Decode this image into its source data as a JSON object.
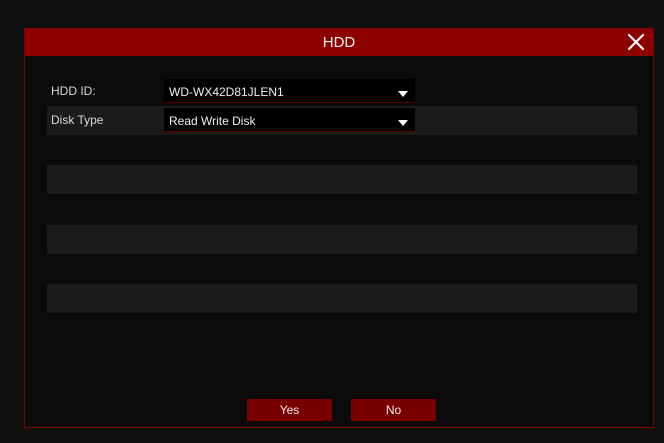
{
  "dialog": {
    "title": "HDD",
    "close_icon": "close-icon"
  },
  "form": {
    "hdd_id": {
      "label": "HDD ID:",
      "value": "WD-WX42D81JLEN1"
    },
    "disk_type": {
      "label": "Disk Type",
      "value": "Read Write Disk"
    }
  },
  "buttons": {
    "yes": "Yes",
    "no": "No"
  },
  "colors": {
    "accent": "#8e0000",
    "button": "#7a0000",
    "panel": "#0b0b0b",
    "row_shade": "#1b1b1b"
  }
}
